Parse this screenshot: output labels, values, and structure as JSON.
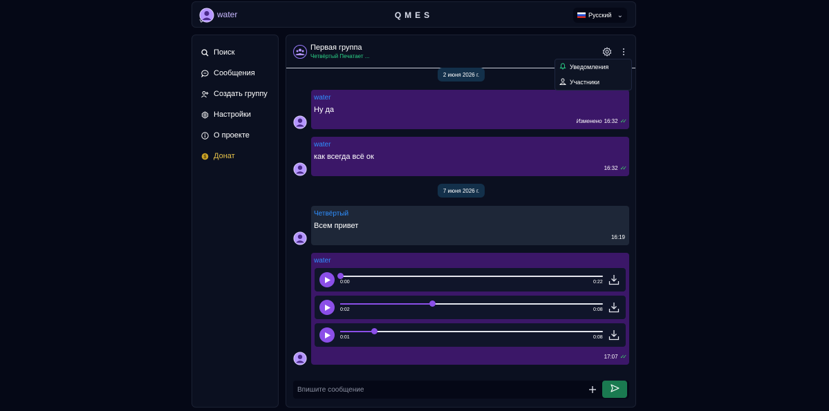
{
  "header": {
    "user_name": "water",
    "app_name": "QMES",
    "language": "Русский"
  },
  "sidebar": {
    "items": [
      {
        "label": "Поиск",
        "icon": "search-icon"
      },
      {
        "label": "Сообщения",
        "icon": "chat-icon"
      },
      {
        "label": "Создать группу",
        "icon": "group-add-icon"
      },
      {
        "label": "Настройки",
        "icon": "gear-icon"
      },
      {
        "label": "О проекте",
        "icon": "info-icon"
      },
      {
        "label": "Донат",
        "icon": "coin-icon"
      }
    ]
  },
  "chat": {
    "group_name": "Первая группа",
    "status": "Четвёртый Печатает ...",
    "menu": {
      "notifications": "Уведомления",
      "members": "Участники"
    },
    "dates": [
      "2 июня 2026 г.",
      "7 июня 2026 г."
    ],
    "messages": [
      {
        "sender": "water",
        "text": "Ну да",
        "edited": "Изменено",
        "time": "16:32"
      },
      {
        "sender": "water",
        "text": "как всегда всё ок",
        "time": "16:32"
      },
      {
        "sender": "Четвёртый",
        "text": "Всем привет",
        "time": "16:19"
      },
      {
        "sender": "water",
        "time": "17:07",
        "audios": [
          {
            "current": "0:00",
            "total": "0:22",
            "progress": 0.0
          },
          {
            "current": "0:02",
            "total": "0:08",
            "progress": 0.35
          },
          {
            "current": "0:01",
            "total": "0:08",
            "progress": 0.13
          }
        ]
      }
    ],
    "composer_placeholder": "Впишите сообщение"
  },
  "colors": {
    "accent": "#8b4fe8",
    "own_bubble": "#3b1768",
    "other_bubble": "#1e2738",
    "sender_name": "#2f8fff",
    "typing_status": "#2bd488",
    "donate": "#e6c24a",
    "send_button": "#1a7a50"
  }
}
